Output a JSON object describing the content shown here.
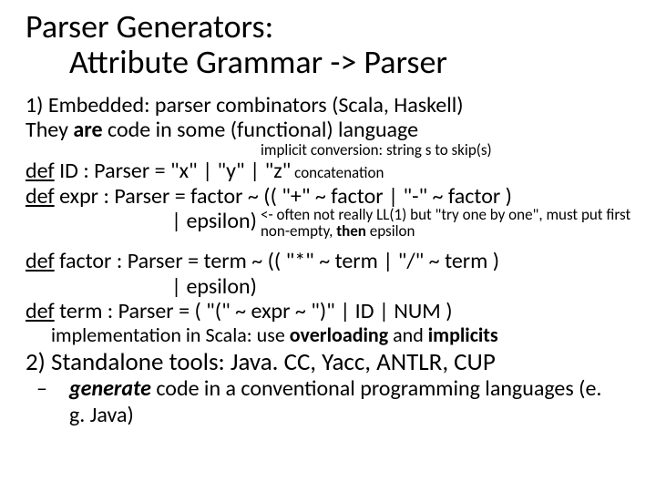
{
  "title": {
    "line1": "Parser Generators:",
    "line2": "Attribute Grammar -> Parser"
  },
  "sec1": {
    "l1": "1) Embedded: parser combinators (Scala, Haskell)",
    "l2a": "They ",
    "l2b": "are",
    "l2c": " code in some (functional) language",
    "annot1": "implicit conversion: string s to skip(s)",
    "id_def": "def",
    "id_rest": " ID : Parser = \"x\" | \"y\" | \"z\"",
    "annot2": " concatenation",
    "expr_def": "def",
    "expr_rest": " expr : Parser = factor ~ (( \"+\" ~ factor | \"-\" ~ factor )",
    "eps1": "| epsilon)",
    "eps_note_a": "<- often not really LL(1) but \"try one by one\",  must put first non-empty, ",
    "eps_note_b": "then",
    "eps_note_c": " epsilon",
    "factor_def": "def",
    "factor_rest": " factor : Parser = term ~ (( \"*\" ~ term | \"/\" ~ term )",
    "eps2": "| epsilon)",
    "term_def": "def",
    "term_rest": " term : Parser = ( \"(\" ~ expr ~ \")\" | ID | NUM )",
    "impl_a": "implementation in Scala: use ",
    "impl_b": "overloading",
    "impl_c": " and ",
    "impl_d": "implicits"
  },
  "sec2": {
    "l1": "2) Standalone tools: Java. CC, Yacc, ANTLR, CUP",
    "sub_a": "generate",
    "sub_b": " code in a conventional programming languages (e. g. Java)"
  }
}
